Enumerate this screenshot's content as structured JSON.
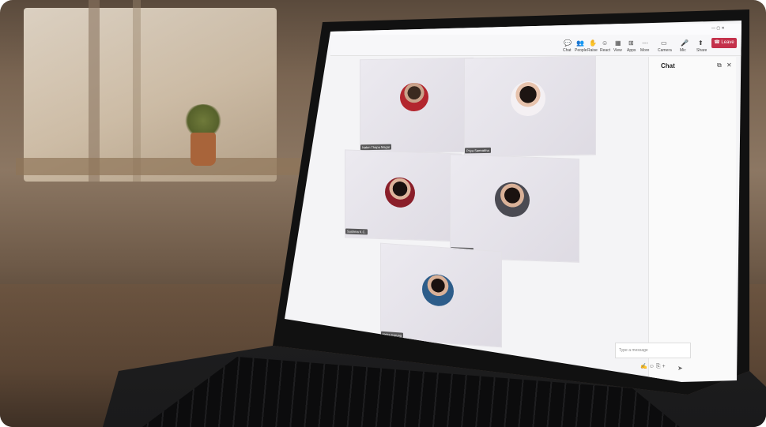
{
  "meeting": {
    "window_controls": "— ▢ ✕",
    "toolbar": [
      {
        "label": "Chat",
        "icon": "chat-icon"
      },
      {
        "label": "People",
        "icon": "people-icon"
      },
      {
        "label": "Raise",
        "icon": "hand-icon"
      },
      {
        "label": "React",
        "icon": "smile-icon"
      },
      {
        "label": "View",
        "icon": "grid-icon"
      },
      {
        "label": "Apps",
        "icon": "apps-icon"
      },
      {
        "label": "More",
        "icon": "more-icon"
      },
      {
        "label": "Camera",
        "icon": "camera-icon"
      },
      {
        "label": "Mic",
        "icon": "mic-icon"
      },
      {
        "label": "Share",
        "icon": "share-icon"
      }
    ],
    "leave_label": "Leave",
    "participants": [
      {
        "name": "Nabin Thapa Magar"
      },
      {
        "name": "Priya Samrabha"
      },
      {
        "name": "Sushma K.C."
      },
      {
        "name": "Pooja Rokaya"
      },
      {
        "name": "Neha Gurung"
      }
    ],
    "chat": {
      "title": "Chat",
      "placeholder": "Type a message"
    },
    "colors": {
      "leave": "#c4314b",
      "accent": "#5b5fc7"
    }
  }
}
